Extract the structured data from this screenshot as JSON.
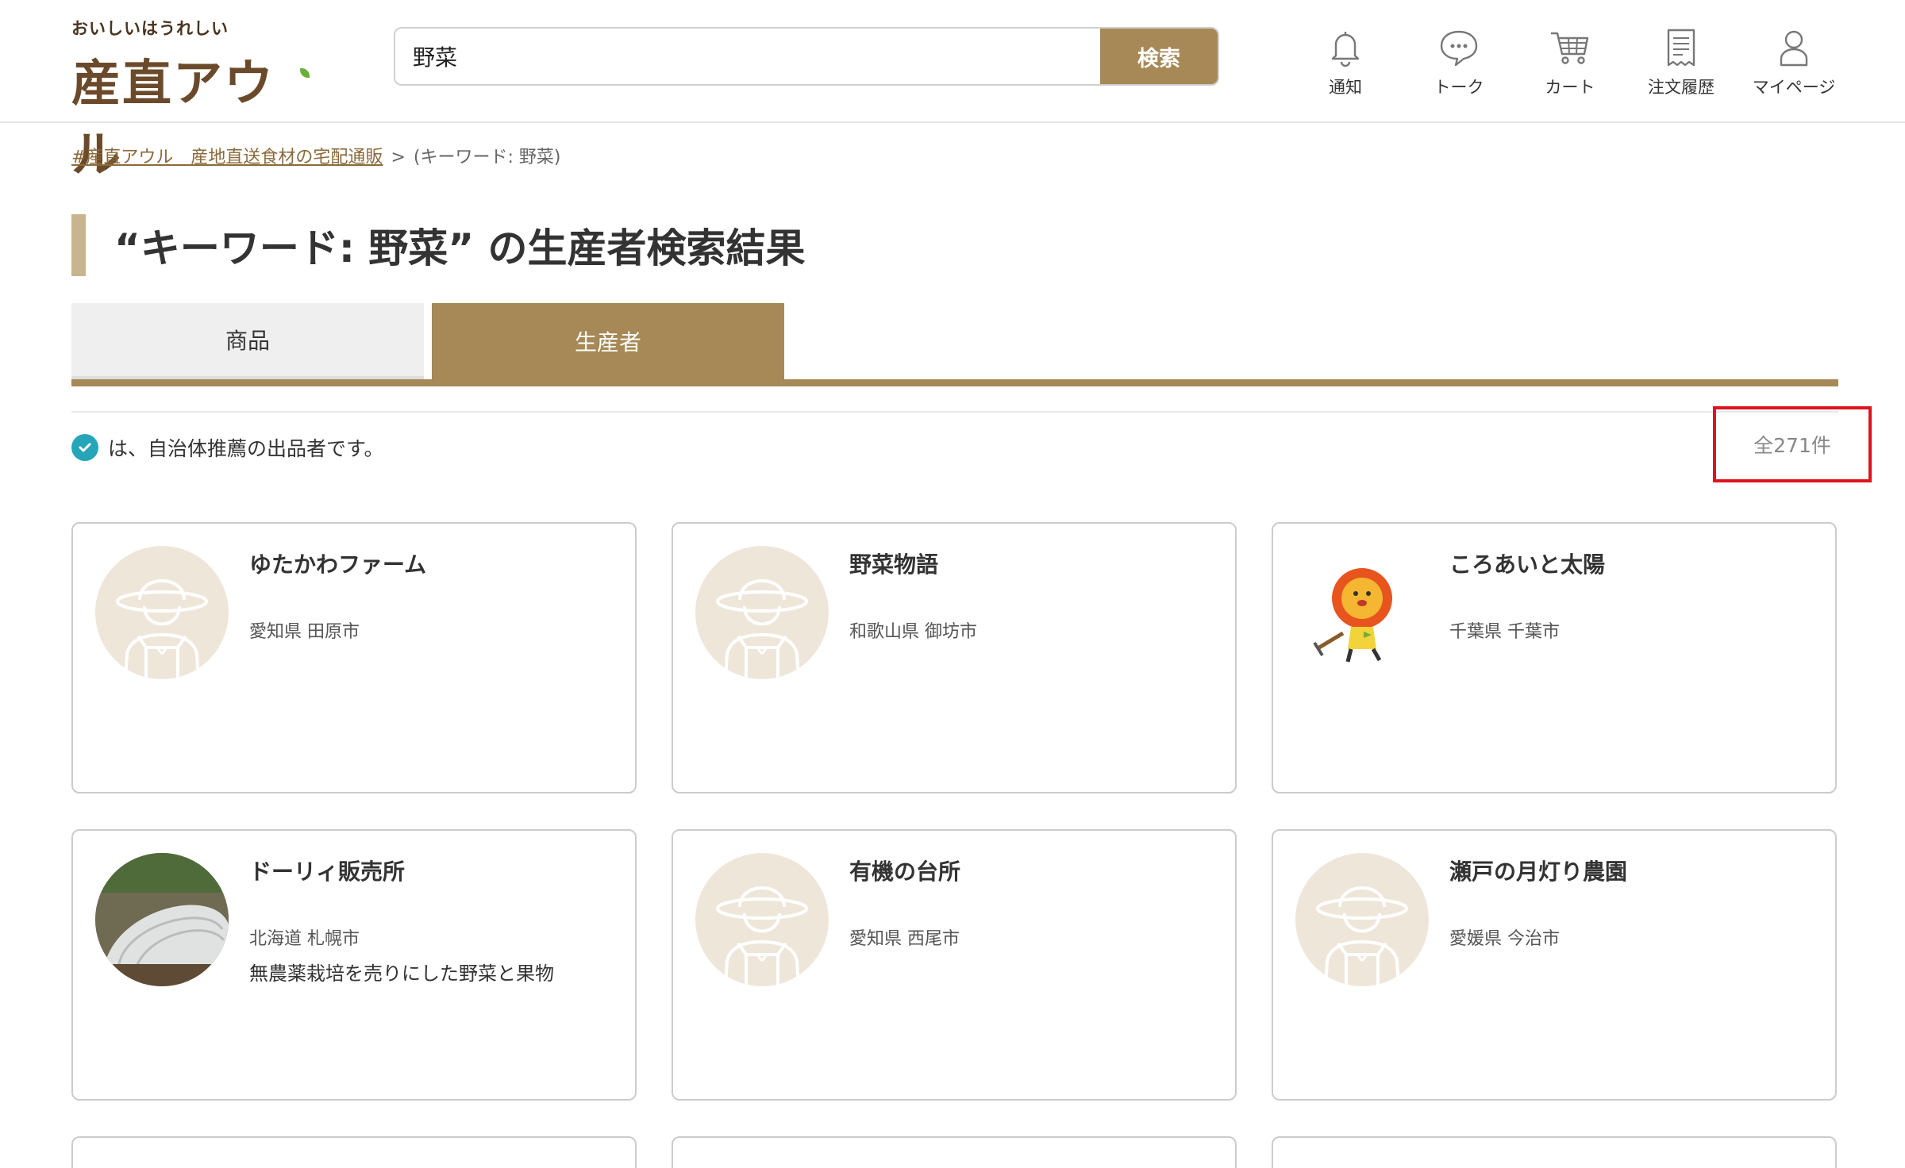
{
  "header": {
    "logo_tagline": "おいしいはうれしい",
    "logo_name": "産直アウル",
    "search": {
      "value": "野菜",
      "button_label": "検索"
    },
    "nav": [
      {
        "label": "通知",
        "icon": "bell-icon"
      },
      {
        "label": "トーク",
        "icon": "chat-bubble-icon"
      },
      {
        "label": "カート",
        "icon": "cart-icon"
      },
      {
        "label": "注文履歴",
        "icon": "receipt-icon"
      },
      {
        "label": "マイページ",
        "icon": "user-icon"
      }
    ]
  },
  "breadcrumb": {
    "home_link": "#産直アウル　産地直送食材の宅配通販",
    "separator": ">",
    "current": "(キーワード: 野菜)"
  },
  "page_title": "“キーワード: 野菜” の生産者検索結果",
  "tabs": [
    {
      "label": "商品",
      "active": false
    },
    {
      "label": "生産者",
      "active": true
    }
  ],
  "notice": {
    "text": "は、自治体推薦の出品者です。"
  },
  "result_count": "全271件",
  "colors": {
    "accent": "#a68956",
    "badge": "#26a5b8",
    "highlight": "#e0121c"
  },
  "producers": [
    {
      "name": "ゆたかわファーム",
      "location": "愛知県 田原市",
      "description": "",
      "avatar": "placeholder"
    },
    {
      "name": "野菜物語",
      "location": "和歌山県 御坊市",
      "description": "",
      "avatar": "placeholder"
    },
    {
      "name": "ころあいと太陽",
      "location": "千葉県 千葉市",
      "description": "",
      "avatar": "lion-illustration"
    },
    {
      "name": "ドーリィ販売所",
      "location": "北海道 札幌市",
      "description": "無農薬栽培を売りにした野菜と果物",
      "avatar": "greenhouse-photo"
    },
    {
      "name": "有機の台所",
      "location": "愛知県 西尾市",
      "description": "",
      "avatar": "placeholder"
    },
    {
      "name": "瀬戸の月灯り農園",
      "location": "愛媛県 今治市",
      "description": "",
      "avatar": "placeholder"
    }
  ]
}
